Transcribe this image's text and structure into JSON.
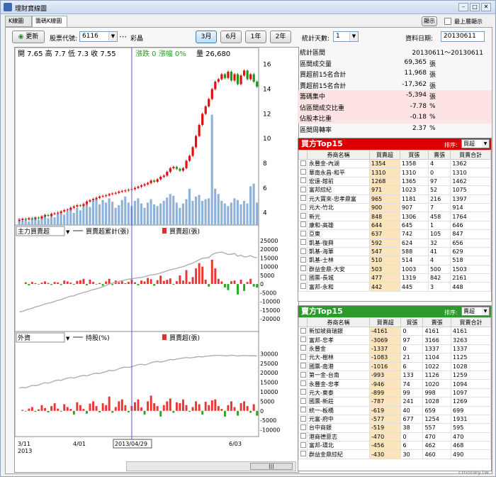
{
  "window": {
    "title": "理財寶線圖"
  },
  "tabs": [
    "K線圖",
    "籌碼K線圖"
  ],
  "top_right": {
    "btn": "顯示",
    "checkbox_label": "最上層顯示"
  },
  "toolbar": {
    "refresh": "更新",
    "code_label": "股票代號:",
    "code_value": "6116",
    "name": "彩晶",
    "periods": [
      "3月",
      "6月",
      "1年",
      "2年"
    ],
    "selected_period": "3月"
  },
  "right_toolbar": {
    "days_label": "統計天數:",
    "days_value": "1",
    "date_label": "資料日期:",
    "date_value": "20130611"
  },
  "ohlc": {
    "open_label": "開",
    "open": "7.65",
    "high_label": "高",
    "high": "7.7",
    "low_label": "低",
    "low": "7.3",
    "close_label": "收",
    "close": "7.55",
    "chg_label": "漲跌",
    "chg": "0",
    "pct_label": "漲幅",
    "pct": "0%",
    "vol_label": "量",
    "vol": "26,680"
  },
  "panel2": {
    "select": "主力買賣超",
    "legend_line": "買賣超累計(張)",
    "legend_bar": "買賣超(張)"
  },
  "panel3": {
    "select": "外資",
    "legend_line": "持股(%)",
    "legend_bar": "買賣超(張)"
  },
  "price_ticks": [
    "16",
    "14",
    "12",
    "10",
    "8",
    "6",
    "4"
  ],
  "p2_ticks": [
    "25000",
    "20000",
    "15000",
    "10000",
    "5000",
    "0",
    "-5000",
    "-10000",
    "-15000",
    "-20000"
  ],
  "p3_ticks": [
    "30000",
    "25000",
    "20000",
    "15000",
    "10000",
    "5000",
    "0",
    "-5000",
    "-10000"
  ],
  "x_labels": {
    "start": "3/11",
    "year": "2013",
    "apr": "4/01",
    "jun": "6/03",
    "cursor": "2013/04/29"
  },
  "stats": [
    {
      "k": "統計區間",
      "v": "20130611～20130611",
      "u": "",
      "pink": false,
      "hd": true
    },
    {
      "k": "區間成交量",
      "v": "69,365",
      "u": "張",
      "pink": false
    },
    {
      "k": "買超前15名合計",
      "v": "11,968",
      "u": "張",
      "pink": false
    },
    {
      "k": "賣超前15名合計",
      "v": "-17,362",
      "u": "張",
      "pink": false
    },
    {
      "k": "籌碼集中",
      "v": "-5,394",
      "u": "張",
      "pink": true
    },
    {
      "k": "佔區間成交比重",
      "v": "-7.78",
      "u": "%",
      "pink": true
    },
    {
      "k": "佔股本比重",
      "v": "-0.18",
      "u": "%",
      "pink": true
    },
    {
      "k": "區間周轉率",
      "v": "2.37",
      "u": "%",
      "pink": false
    }
  ],
  "buy_table": {
    "title": "買方Top15",
    "sort_label": "排序:",
    "sort_value": "買超",
    "headers": [
      "券商名稱",
      "買賣超",
      "買張",
      "賣張",
      "買賣合計"
    ],
    "rows": [
      [
        "永豐金-內湖",
        "1354",
        "1358",
        "4",
        "1362"
      ],
      [
        "華南永昌-和平",
        "1310",
        "1310",
        "0",
        "1310"
      ],
      [
        "宏遠-館前",
        "1268",
        "1365",
        "97",
        "1462"
      ],
      [
        "富邦綜紀",
        "971",
        "1023",
        "52",
        "1075"
      ],
      [
        "元大寶來-忠孝鼎富",
        "965",
        "1181",
        "216",
        "1397"
      ],
      [
        "元大-竹北",
        "900",
        "907",
        "7",
        "914"
      ],
      [
        "新光",
        "848",
        "1306",
        "458",
        "1764"
      ],
      [
        "康和-高雄",
        "644",
        "645",
        "1",
        "646"
      ],
      [
        "亞東",
        "637",
        "742",
        "105",
        "847"
      ],
      [
        "凱基-復興",
        "592",
        "624",
        "32",
        "656"
      ],
      [
        "凱基-海華",
        "547",
        "588",
        "41",
        "629"
      ],
      [
        "凱基-士林",
        "510",
        "514",
        "4",
        "518"
      ],
      [
        "群益金鼎-大安",
        "503",
        "1003",
        "500",
        "1503"
      ],
      [
        "國票-長城",
        "477",
        "1319",
        "842",
        "2161"
      ],
      [
        "富邦-永和",
        "442",
        "445",
        "3",
        "448"
      ]
    ]
  },
  "sell_table": {
    "title": "賣方Top15",
    "sort_label": "排序:",
    "sort_value": "賣超",
    "headers": [
      "券商名稱",
      "買賣超",
      "買張",
      "賣張",
      "買賣合計"
    ],
    "rows": [
      [
        "新加坡商瑞銀",
        "-4161",
        "0",
        "4161",
        "4161"
      ],
      [
        "富邦-忠孝",
        "-3069",
        "97",
        "3166",
        "3263"
      ],
      [
        "永豐金",
        "-1337",
        "0",
        "1337",
        "1337"
      ],
      [
        "元大-樹林",
        "-1083",
        "21",
        "1104",
        "1125"
      ],
      [
        "國票-南港",
        "-1016",
        "6",
        "1022",
        "1028"
      ],
      [
        "第一金-台南",
        "-993",
        "133",
        "1126",
        "1259"
      ],
      [
        "永豐金-忠孝",
        "-946",
        "74",
        "1020",
        "1094"
      ],
      [
        "元大-東泰",
        "-899",
        "99",
        "998",
        "1097"
      ],
      [
        "國票-新莊",
        "-787",
        "241",
        "1028",
        "1269"
      ],
      [
        "統一-板橋",
        "-619",
        "40",
        "659",
        "699"
      ],
      [
        "元富-府中",
        "-577",
        "677",
        "1254",
        "1931"
      ],
      [
        "台中商銀",
        "-519",
        "38",
        "557",
        "595"
      ],
      [
        "港商德意志",
        "-470",
        "0",
        "470",
        "470"
      ],
      [
        "富邦-環北",
        "-456",
        "6",
        "462",
        "468"
      ],
      [
        "群益金鼎綜紀",
        "-430",
        "30",
        "460",
        "490"
      ]
    ]
  },
  "watermark": "cmoney.tw",
  "chart_data": [
    {
      "type": "candlestick",
      "ylim": [
        3,
        16.5
      ],
      "closes": [
        3.4,
        3.5,
        3.45,
        3.55,
        3.5,
        3.6,
        3.55,
        3.7,
        3.8,
        3.75,
        3.9,
        3.95,
        4.0,
        4.1,
        4.2,
        4.25,
        4.4,
        4.5,
        4.6,
        4.55,
        4.7,
        4.9,
        5.0,
        5.1,
        5.2,
        5.3,
        5.35,
        5.4,
        5.5,
        5.55,
        5.6,
        5.7,
        5.75,
        5.8,
        5.85,
        5.9,
        6.0,
        6.1,
        6.2,
        6.3,
        6.4,
        6.6,
        6.5,
        6.7,
        6.9,
        7.0,
        7.3,
        7.6,
        7.7,
        7.55,
        7.4,
        7.6,
        8.2,
        8.6,
        9.3,
        10.2,
        11.1,
        12.0,
        12.6,
        13.2,
        14.0,
        14.6,
        14.8,
        15.2,
        14.9,
        15.4,
        14.7,
        15.2,
        14.4,
        15.1,
        15.5,
        14.8,
        15.2,
        14.6,
        14.2
      ],
      "volume": [
        0.8,
        0.5,
        0.6,
        0.4,
        0.7,
        0.9,
        0.6,
        1.0,
        1.2,
        0.8,
        1.1,
        0.9,
        1.3,
        1.5,
        1.2,
        1.6,
        1.8,
        1.4,
        2.0,
        1.7,
        2.2,
        2.5,
        2.1,
        2.8,
        3.0,
        2.4,
        2.9,
        2.6,
        3.1,
        2.7,
        2.0,
        2.3,
        2.9,
        3.3,
        2.6,
        2.2,
        2.8,
        3.1,
        2.5,
        2.0,
        2.6,
        3.0,
        2.4,
        2.2,
        2.5,
        2.8,
        3.2,
        3.6,
        3.4,
        2.6,
        2.0,
        2.5,
        3.0,
        4.2,
        2.8,
        3.3,
        3.5,
        2.8,
        3.0,
        3.1,
        12.8,
        4.2,
        3.6,
        2.8,
        2.5,
        2.2,
        2.6,
        3.1,
        2.9,
        2.4,
        2.8,
        2.5,
        4.5,
        4.8,
        2.6
      ]
    },
    {
      "type": "bar+line",
      "title": "主力買賣超",
      "ylim": [
        -20000,
        25000
      ],
      "bars": [
        0,
        0,
        1000,
        -800,
        1200,
        500,
        -300,
        800,
        1500,
        600,
        -500,
        1200,
        900,
        -600,
        2000,
        1500,
        800,
        -400,
        1800,
        2200,
        3000,
        -800,
        2500,
        1200,
        -300,
        600,
        -1000,
        1500,
        3000,
        -600,
        2000,
        1000,
        1600,
        500,
        1200,
        2500,
        1000,
        -800,
        2000,
        1500,
        3500,
        2800,
        -1000,
        2200,
        4800,
        1800,
        2400,
        3200,
        -400,
        1600,
        5000,
        2000,
        8000,
        1200,
        4000,
        9000,
        12000,
        10000,
        2500,
        -1500,
        14000,
        9000,
        3000,
        1500,
        -2000,
        -3500,
        1600,
        2000,
        -6000,
        2500,
        -4000,
        1200,
        3000,
        -1500,
        -2000
      ],
      "line": [
        -16000,
        -15800,
        -15000,
        -14500,
        -14000,
        -13200,
        -12800,
        -12200,
        -11500,
        -11000,
        -10700,
        -10000,
        -9400,
        -9000,
        -8200,
        -7600,
        -7000,
        -6800,
        -6000,
        -5500,
        -4800,
        -4500,
        -3800,
        -3200,
        -2800,
        -2200,
        -1600,
        -800,
        0,
        500,
        1000,
        1500,
        2000,
        2400,
        2800,
        3000,
        3300,
        3600,
        3800,
        4200,
        4800,
        5200,
        5400,
        5800,
        6400,
        7000,
        7600,
        8200,
        8600,
        9000,
        9600,
        10000,
        10800,
        11400,
        12000,
        13000,
        14000,
        14800,
        15000,
        15200,
        17000,
        17800,
        18200,
        18400,
        17800,
        17000,
        17200,
        17600,
        16000,
        16600,
        15600,
        15800,
        16400,
        15400,
        15200
      ]
    },
    {
      "type": "bar+line",
      "title": "外資",
      "ylim": [
        -12000,
        32000
      ],
      "bars": [
        0,
        500,
        -300,
        1200,
        2000,
        -500,
        800,
        3000,
        1500,
        -800,
        2500,
        4000,
        1200,
        -400,
        3500,
        2000,
        1000,
        -2000,
        4500,
        3000,
        1000,
        -1500,
        3800,
        5000,
        2500,
        -800,
        4000,
        3000,
        7500,
        -1000,
        2000,
        5000,
        6000,
        3000,
        -800,
        2500,
        4500,
        6000,
        1800,
        -2000,
        5000,
        8000,
        4000,
        2500,
        -3000,
        3000,
        5000,
        6500,
        -1000,
        4500,
        4000,
        6000,
        3000,
        -500,
        2000,
        5000,
        3500,
        -2000,
        4800,
        3000,
        5500,
        6000,
        2500,
        1000,
        -3000,
        3000,
        5000,
        2000,
        -2500,
        4000,
        5000,
        2500,
        -1000,
        3500,
        -2500
      ],
      "line": [
        12000,
        12300,
        12100,
        12700,
        13400,
        13200,
        13600,
        14300,
        14800,
        14500,
        15100,
        15800,
        16200,
        16000,
        16700,
        17200,
        17500,
        17200,
        17800,
        18300,
        18600,
        18400,
        18900,
        19500,
        19800,
        19600,
        20200,
        20600,
        21300,
        21000,
        21400,
        22100,
        22700,
        23000,
        22800,
        23200,
        23700,
        24300,
        24500,
        24100,
        24600,
        25300,
        25700,
        26000,
        25600,
        26000,
        26500,
        27000,
        26800,
        27200,
        27500,
        27800,
        28000,
        27800,
        28000,
        28300,
        28500,
        28300,
        28700,
        28800,
        29000,
        29100,
        29200,
        29100,
        28900,
        29000,
        29200,
        29100,
        28800,
        29000,
        29100,
        29000,
        28900,
        29000,
        28800
      ]
    }
  ]
}
